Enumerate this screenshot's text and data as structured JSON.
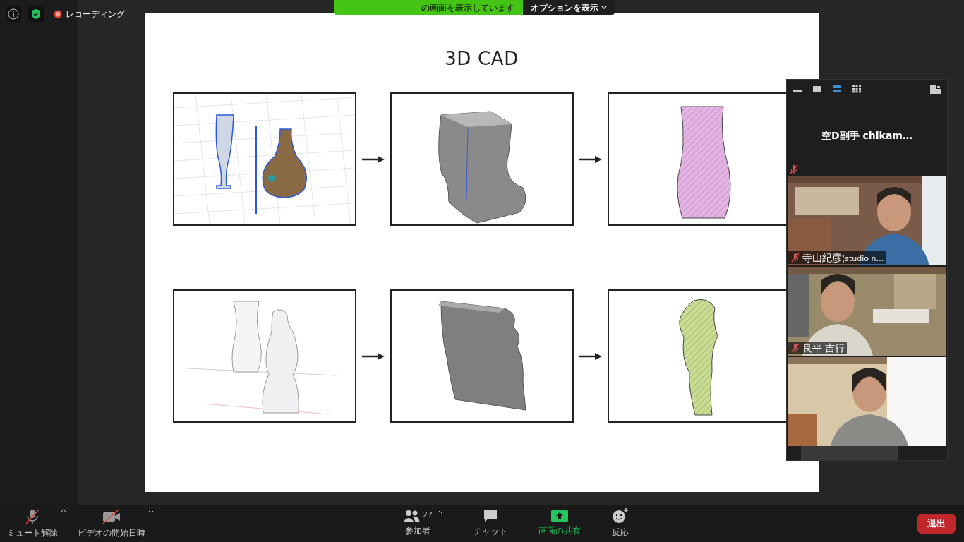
{
  "top_bar": {
    "recording_label": "レコーディング",
    "recording": true
  },
  "share_banner": {
    "text": "の画面を表示しています",
    "options_button": "オプションを表示"
  },
  "slide": {
    "title": "3D CAD",
    "rows": [
      {
        "panels": [
          {
            "kind": "wireframe"
          },
          {
            "kind": "solid"
          },
          {
            "kind": "section",
            "color": "#e7b3e6"
          }
        ]
      },
      {
        "panels": [
          {
            "kind": "sketch"
          },
          {
            "kind": "extrusion"
          },
          {
            "kind": "section",
            "color": "#c9dd8f"
          }
        ]
      }
    ]
  },
  "video_panel": {
    "speaker": {
      "name": "空D副手 chikam…",
      "muted": true
    },
    "participants": [
      {
        "kind": "video",
        "name": "寺山紀彦",
        "name_suffix": "(studio n…",
        "muted": true
      },
      {
        "kind": "video",
        "name": "良平 吉行",
        "muted": true
      },
      {
        "kind": "video"
      }
    ]
  },
  "toolbar": {
    "left": [
      {
        "kind": "mic",
        "label": "ミュート解除",
        "off": true
      },
      {
        "kind": "video",
        "label": "ビデオの開始日時",
        "off": true
      }
    ],
    "center": [
      {
        "kind": "participants",
        "label": "参加者",
        "count": "27",
        "caret": true
      },
      {
        "kind": "chat",
        "label": "チャット"
      },
      {
        "kind": "share",
        "label": "画面の共有"
      },
      {
        "kind": "reaction",
        "label": "反応"
      }
    ],
    "leave_button": "退出"
  }
}
